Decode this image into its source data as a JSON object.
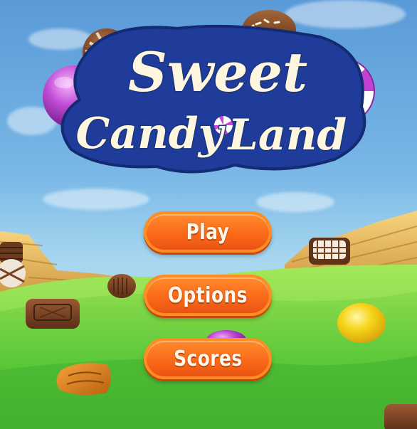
{
  "game": {
    "title_line1": "Sweet",
    "title_line2_left": "Candy",
    "title_line2_right": "Land"
  },
  "menu": {
    "play_label": "Play",
    "options_label": "Options",
    "scores_label": "Scores"
  },
  "colors": {
    "button_orange": "#fb6a1a",
    "title_cream": "#fff6df",
    "title_outline": "#1e3f9c",
    "grass": "#56c23a",
    "sky": "#78b7e6"
  }
}
